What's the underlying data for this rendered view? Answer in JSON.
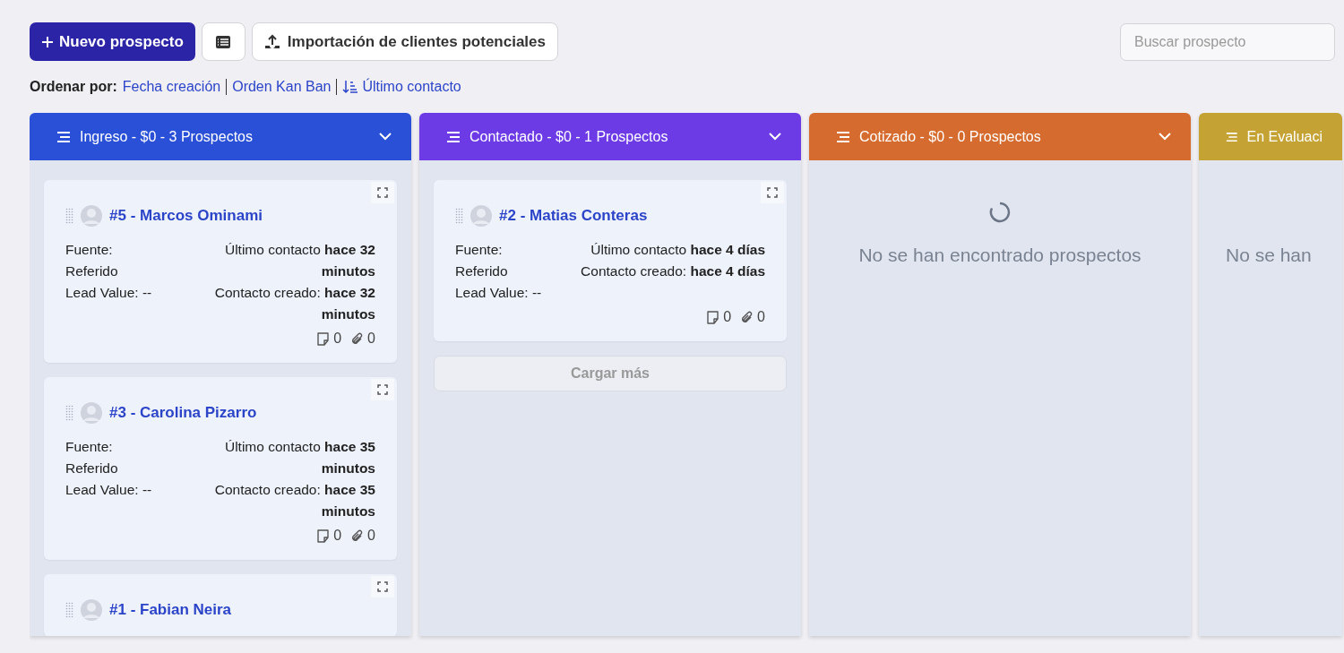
{
  "toolbar": {
    "new_button": "Nuevo prospecto",
    "import_button": "Importación de clientes potenciales",
    "search": {
      "placeholder": "Buscar prospecto"
    }
  },
  "sort": {
    "label": "Ordenar por:",
    "options": [
      {
        "label": "Fecha creación",
        "selected": false
      },
      {
        "label": "Orden Kan Ban",
        "selected": false
      },
      {
        "label": "Último contacto",
        "selected": true
      }
    ]
  },
  "columns": [
    {
      "title": "Ingreso - $0 - 3 Prospectos",
      "color": "#2950d6",
      "partial": false,
      "cards": [
        {
          "title": "#5 - Marcos Ominami",
          "source": "Fuente: Referido",
          "value": "Lead Value: --",
          "last_contact": "Último contacto **hace 32 minutos**",
          "created": "Contacto creado: **hace 32 minutos**",
          "notes": "0",
          "attachments": "0"
        },
        {
          "title": "#3 - Carolina Pizarro",
          "source": "Fuente: Referido",
          "value": "Lead Value: --",
          "last_contact": "Último contacto **hace 35 minutos**",
          "created": "Contacto creado: **hace 35 minutos**",
          "notes": "0",
          "attachments": "0"
        },
        {
          "title": "#1 - Fabian Neira"
        }
      ]
    },
    {
      "title": "Contactado - $0 - 1 Prospectos",
      "color": "#6c3be6",
      "partial": false,
      "cards": [
        {
          "title": "#2 - Matias Conteras",
          "source": "Fuente: Referido",
          "value": "Lead Value: --",
          "last_contact": "Último contacto **hace 4 días**",
          "created": "Contacto creado: **hace 4 días**",
          "notes": "0",
          "attachments": "0"
        }
      ],
      "load_more": "Cargar más"
    },
    {
      "title": "Cotizado - $0 - 0 Prospectos",
      "color": "#d56b2e",
      "partial": false,
      "empty": "No se han encontrado prospectos"
    },
    {
      "title": "En Evaluaci",
      "color": "#c4a233",
      "empty": "No se han",
      "partial": true
    }
  ]
}
